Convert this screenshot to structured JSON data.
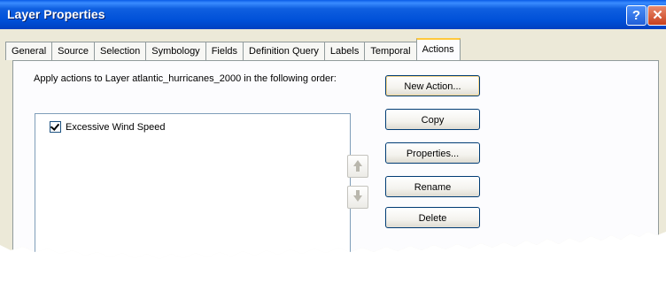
{
  "window": {
    "title": "Layer Properties"
  },
  "titlebar": {
    "help_label": "?",
    "close_label": "✕"
  },
  "tabs": [
    {
      "label": "General"
    },
    {
      "label": "Source"
    },
    {
      "label": "Selection"
    },
    {
      "label": "Symbology"
    },
    {
      "label": "Fields"
    },
    {
      "label": "Definition Query"
    },
    {
      "label": "Labels"
    },
    {
      "label": "Temporal"
    },
    {
      "label": "Actions",
      "active": true
    }
  ],
  "actions_panel": {
    "description": "Apply actions to Layer atlantic_hurricanes_2000 in the following order:",
    "list_items": [
      {
        "label": "Excessive Wind Speed",
        "checked": true
      }
    ],
    "buttons": {
      "new_action": "New Action...",
      "copy": "Copy",
      "properties": "Properties...",
      "rename": "Rename",
      "delete": "Delete"
    },
    "move_up_icon": "arrow-up-icon",
    "move_down_icon": "arrow-down-icon"
  },
  "colors": {
    "titlebar": "#0050d8",
    "dialog_bg": "#ece9d8",
    "active_tab_accent": "#ffc83c",
    "button_border": "#003c74"
  }
}
